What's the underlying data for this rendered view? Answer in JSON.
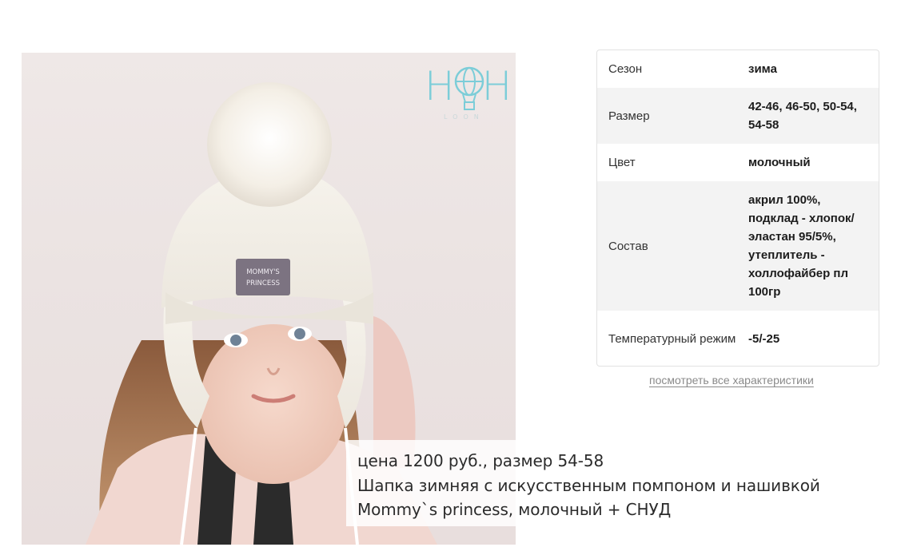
{
  "product": {
    "photo_alt": "",
    "brand_logo": {
      "letters": "HH",
      "sub": "LOON",
      "icon": "balloon-icon",
      "color": "#7ccdd8"
    },
    "hat_patch": [
      "MOMMY'S",
      "PRINCESS"
    ],
    "caption": {
      "line1": "цена 1200 руб., размер 54-58",
      "line2": "Шапка зимняя с искусственным помпоном и нашивкой",
      "line3": "Mommy`s princess, молочный + СНУД"
    }
  },
  "specs": {
    "rows": [
      {
        "label": "Сезон",
        "value": "зима"
      },
      {
        "label": "Размер",
        "value": "42-46, 46-50, 50-54, 54-58"
      },
      {
        "label": "Цвет",
        "value": "молочный"
      },
      {
        "label": "Состав",
        "value": "акрил 100%, подклад - хлопок/эластан 95/5%, утеплитель - холлофайбер пл 100гр"
      },
      {
        "label": "Температурный режим",
        "value": "-5/-25"
      }
    ],
    "all_link": "посмотреть все характеристики"
  },
  "colors": {
    "row_shade": "#f3f3f3",
    "border": "#e2e2e2",
    "logo_accent": "#7ccdd8"
  }
}
